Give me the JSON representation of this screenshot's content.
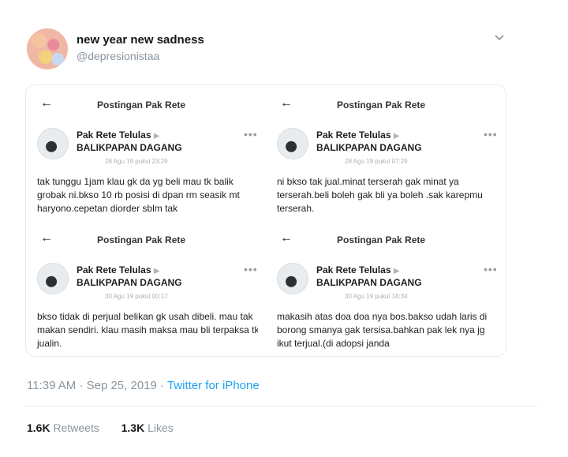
{
  "tweet": {
    "display_name": "new year new sadness",
    "handle": "@depresionistaa",
    "timestamp": "11:39 AM",
    "date": "Sep 25, 2019",
    "separator": "·",
    "source": "Twitter for iPhone",
    "retweets_count": "1.6K",
    "retweets_label": "Retweets",
    "likes_count": "1.3K",
    "likes_label": "Likes",
    "menu_icon": "chevron-down-icon"
  },
  "panels": [
    {
      "header": "Postingan Pak Rete",
      "author": "Pak Rete Telulas",
      "group": "BALIKPAPAN DAGANG",
      "date": "28 Agu 19 pukul 23:29",
      "text": "tak tunggu 1jam klau gk da yg beli mau tk balik grobak ni.bkso 10 rb posisi di dpan rm seasik mt haryono.cepetan diorder sblm tak"
    },
    {
      "header": "Postingan Pak Rete",
      "author": "Pak Rete Telulas",
      "group": "BALIKPAPAN DAGANG",
      "date": "28 Agu 19 pukul 07:29",
      "text": "ni bkso tak jual.minat terserah gak minat ya terserah.beli boleh gak bli ya boleh .sak karepmu terserah."
    },
    {
      "header": "Postingan Pak Rete",
      "author": "Pak Rete Telulas",
      "group": "BALIKPAPAN DAGANG",
      "date": "30 Agu 19 pukul 00:17",
      "text": "bkso tidak di perjual belikan gk usah dibeli. mau tak makan sendiri. klau masih maksa mau bli terpaksa tk jualin."
    },
    {
      "header": "Postingan Pak Rete",
      "author": "Pak Rete Telulas",
      "group": "BALIKPAPAN DAGANG",
      "date": "30 Agu 19 pukul 18:34",
      "text": "makasih atas doa doa nya bos.bakso udah laris  di borong smanya gak tersisa.bahkan pak lek nya jg ikut terjual.(di adopsi janda"
    }
  ]
}
